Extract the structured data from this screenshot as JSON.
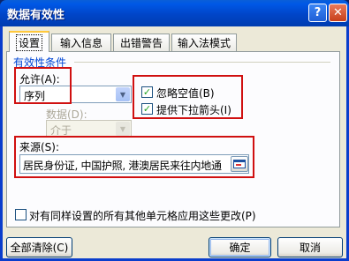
{
  "window": {
    "title": "数据有效性",
    "help_glyph": "?",
    "close_glyph": "✕"
  },
  "tabs": [
    {
      "label": "设置",
      "active": true
    },
    {
      "label": "输入信息",
      "active": false
    },
    {
      "label": "出错警告",
      "active": false
    },
    {
      "label": "输入法模式",
      "active": false
    }
  ],
  "settings": {
    "group_title": "有效性条件",
    "allow_label": "允许(A):",
    "allow_value": "序列",
    "data_label": "数据(D):",
    "data_value": "介于",
    "ignore_blank_label": "忽略空值(B)",
    "ignore_blank_checked": true,
    "dropdown_label": "提供下拉箭头(I)",
    "dropdown_checked": true,
    "source_label": "来源(S):",
    "source_value": "居民身份证, 中国护照, 港澳居民来往内地通",
    "apply_all_label": "对有同样设置的所有其他单元格应用这些更改(P)",
    "apply_all_checked": false,
    "check_glyph": "✓",
    "arrow_glyph": "▼"
  },
  "buttons": {
    "clear_all": "全部清除(C)",
    "ok": "确定",
    "cancel": "取消"
  },
  "colors": {
    "title_bar": "#0054e3",
    "client_bg": "#ece9d8",
    "highlight": "#d01010",
    "group_title": "#0046d5"
  }
}
